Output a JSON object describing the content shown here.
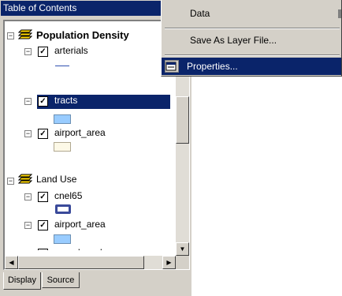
{
  "toc": {
    "title": "Table of Contents",
    "groups": [
      {
        "label": "Population Density",
        "layers": [
          {
            "label": "arterials",
            "checked": true
          },
          {
            "label": "tracts",
            "checked": true,
            "selected": true
          },
          {
            "label": "airport_area",
            "checked": true
          }
        ]
      },
      {
        "label": "Land Use",
        "layers": [
          {
            "label": "cnel65",
            "checked": true
          },
          {
            "label": "airport_area",
            "checked": true
          },
          {
            "label": "parcels_sel",
            "checked": true
          }
        ]
      }
    ],
    "tabs": [
      "Display",
      "Source"
    ],
    "active_tab": "Display"
  },
  "context_menu": {
    "items": [
      {
        "label": "Data",
        "has_submenu": true
      },
      {
        "label": "Save As Layer File..."
      },
      {
        "label": "Properties...",
        "highlighted": true
      }
    ]
  },
  "colors": {
    "selection": "#0a246a",
    "panel": "#d4d0c8",
    "swatch_blue": "#99ccff",
    "swatch_cream": "#fdf9e7",
    "swatch_outline": "#3a4a9a"
  }
}
